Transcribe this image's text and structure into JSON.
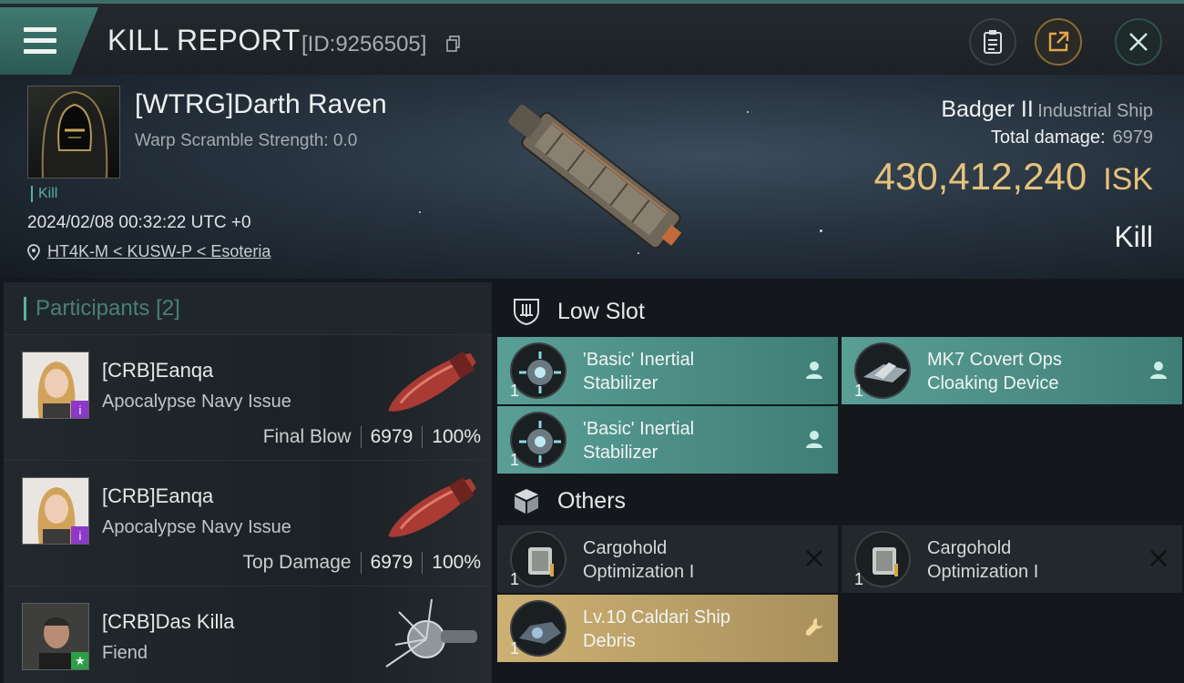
{
  "header": {
    "title": "KILL REPORT",
    "id_text": "[ID:9256505]",
    "icons": [
      "menu-icon",
      "copy-icon",
      "clipboard-icon",
      "share-icon",
      "close-icon"
    ]
  },
  "victim": {
    "name": "[WTRG]Darth Raven",
    "scramble": "Warp Scramble Strength: 0.0",
    "tag": "Kill",
    "datetime": "2024/02/08 00:32:22 UTC +0",
    "location": "HT4K-M < KUSW-P < Esoteria",
    "ship_name": "Badger II",
    "ship_class": "Industrial Ship",
    "total_damage_label": "Total damage:",
    "total_damage": "6979",
    "isk_value": "430,412,240",
    "isk_unit": "ISK",
    "result": "Kill"
  },
  "participants": {
    "title": "Participants",
    "count": "[2]",
    "rows": [
      {
        "name": "[CRB]Eanqa",
        "ship": "Apocalypse Navy Issue",
        "role": "Final Blow",
        "damage": "6979",
        "percent": "100%"
      },
      {
        "name": "[CRB]Eanqa",
        "ship": "Apocalypse Navy Issue",
        "role": "Top Damage",
        "damage": "6979",
        "percent": "100%"
      },
      {
        "name": "[CRB]Das Killa",
        "ship": "Fiend"
      }
    ]
  },
  "fitting": {
    "low_slot_title": "Low Slot",
    "others_title": "Others",
    "low_slot": [
      {
        "qty": "1",
        "line1": "'Basic' Inertial",
        "line2": "Stabilizer"
      },
      {
        "qty": "1",
        "line1": "MK7 Covert Ops",
        "line2": "Cloaking Device"
      },
      {
        "qty": "1",
        "line1": "'Basic' Inertial",
        "line2": "Stabilizer"
      }
    ],
    "others": [
      {
        "qty": "1",
        "line1": "Cargohold",
        "line2": "Optimization I"
      },
      {
        "qty": "1",
        "line1": "Cargohold",
        "line2": "Optimization I"
      },
      {
        "qty": "1",
        "line1": "Lv.10 Caldari Ship",
        "line2": "Debris"
      }
    ]
  },
  "colors": {
    "accent": "#5faea3",
    "isk": "#e6c27a",
    "dropped": "#5a9f97",
    "destroyed": "#23282c",
    "debris": "#cdb072"
  }
}
